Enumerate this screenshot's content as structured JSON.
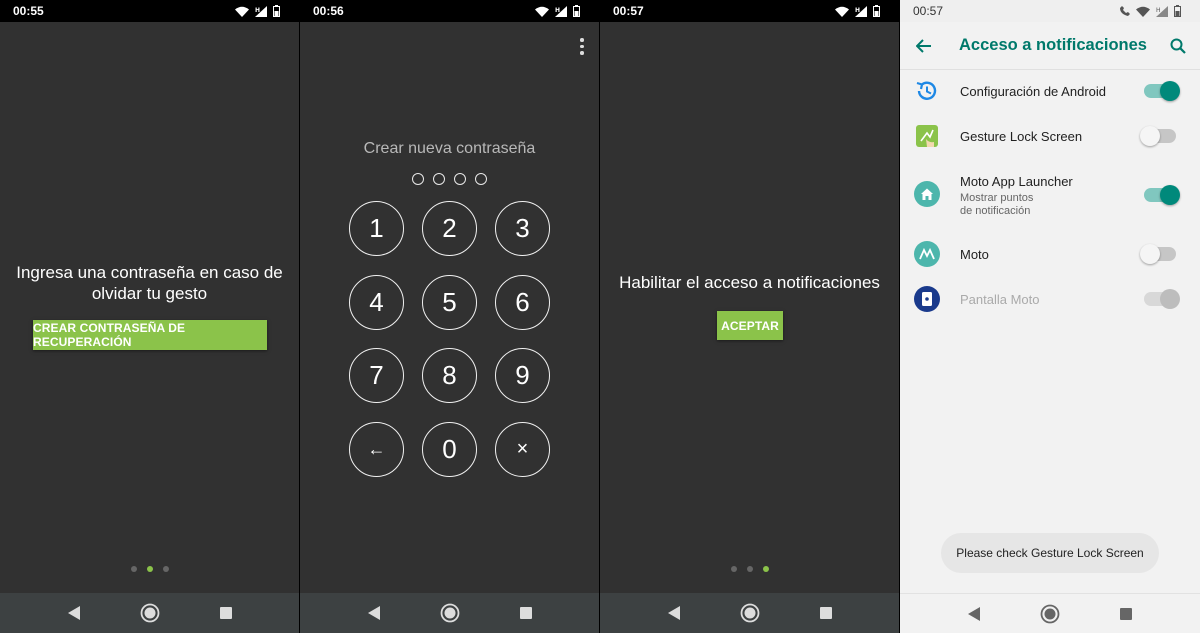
{
  "colors": {
    "accent_green": "#8bc34a",
    "teal": "#00796b",
    "dark_bg": "#313131"
  },
  "screen1": {
    "time": "00:55",
    "message": "Ingresa una contraseña en caso de olvidar tu gesto",
    "button_label": "CREAR CONTRASEÑA DE RECUPERACIÓN",
    "page_indicator": {
      "count": 3,
      "active": 2
    }
  },
  "screen2": {
    "time": "00:56",
    "title": "Crear nueva contraseña",
    "pin_length": 4,
    "keys": [
      "1",
      "2",
      "3",
      "4",
      "5",
      "6",
      "7",
      "8",
      "9",
      "←",
      "0",
      "×"
    ]
  },
  "screen3": {
    "time": "00:57",
    "message": "Habilitar el acceso a notificaciones",
    "button_label": "ACEPTAR",
    "page_indicator": {
      "count": 3,
      "active": 3
    }
  },
  "screen4": {
    "time": "00:57",
    "title": "Acceso a notificaciones",
    "apps": [
      {
        "name": "Configuración de Android",
        "sub": "",
        "state": "on",
        "icon": "android-config-icon"
      },
      {
        "name": "Gesture Lock Screen",
        "sub": "",
        "state": "off",
        "icon": "gesture-lock-icon"
      },
      {
        "name": "Moto App Launcher",
        "sub": "Mostrar puntos de notificación",
        "state": "on",
        "icon": "home-icon"
      },
      {
        "name": "Moto",
        "sub": "",
        "state": "off",
        "icon": "moto-icon"
      },
      {
        "name": "Pantalla Moto",
        "sub": "",
        "state": "disabled",
        "icon": "pantalla-moto-icon"
      }
    ],
    "toast": "Please check Gesture Lock Screen"
  }
}
